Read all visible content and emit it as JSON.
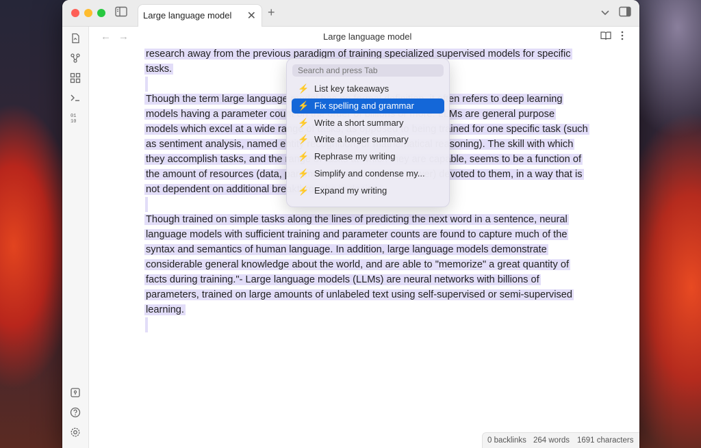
{
  "window": {
    "tab_title": "Large language model",
    "view_title": "Large language model",
    "tab_close": "✕",
    "new_tab": "+"
  },
  "ribbon": {
    "icons": [
      "open-note-icon",
      "graph-view-icon",
      "canvas-icon",
      "command-palette-icon",
      "templates-icon",
      "vault-switcher-icon",
      "help-icon",
      "settings-icon"
    ]
  },
  "document": {
    "paragraphs": [
      "research away from the previous paradigm of training specialized supervised models for specific tasks.",
      "Though the term large language model has no formal definition, it often refers to deep learning models having a parameter count on the order of billions or more. LLMs are general purpose models which excel at a wide range of tasks, as opposed to being trained for one specific task (such as sentiment analysis, named entity recognition, or mathematical reasoning). The skill with which they accomplish tasks, and the range of tasks at which they are capable, seems to be a function of the amount of resources (data, parameter-size, computing power) devoted to them, in a way that is not dependent on additional breakthroughs in design.",
      "Though trained on simple tasks along the lines of predicting the next word in a sentence, neural language models with sufficient training and parameter counts are found to capture much of the syntax and semantics of human language. In addition, large language models demonstrate considerable general knowledge about the world, and are able to \"memorize\" a great quantity of facts during training.\"- Large language models (LLMs) are neural networks with billions of parameters, trained on large amounts of unlabeled text using self-supervised or semi-supervised learning."
    ]
  },
  "popup": {
    "search_placeholder": "Search and press Tab",
    "items": [
      {
        "label": "List key takeaways",
        "icon": "lightning-icon"
      },
      {
        "label": "Fix spelling and grammar",
        "icon": "lightning-icon",
        "active": true
      },
      {
        "label": "Write a short summary",
        "icon": "lightning-icon"
      },
      {
        "label": "Write a longer summary",
        "icon": "lightning-icon"
      },
      {
        "label": "Rephrase my writing",
        "icon": "lightning-icon"
      },
      {
        "label": "Simplify and condense my...",
        "icon": "lightning-icon"
      },
      {
        "label": "Expand my writing",
        "icon": "lightning-icon"
      }
    ],
    "bolt_glyph": "⚡"
  },
  "status": {
    "backlinks": "0 backlinks",
    "words": "264 words",
    "characters": "1691 characters"
  },
  "colors": {
    "selection": "#e2ddf8",
    "accent": "#1467d8",
    "bolt": "#f2a23c"
  }
}
